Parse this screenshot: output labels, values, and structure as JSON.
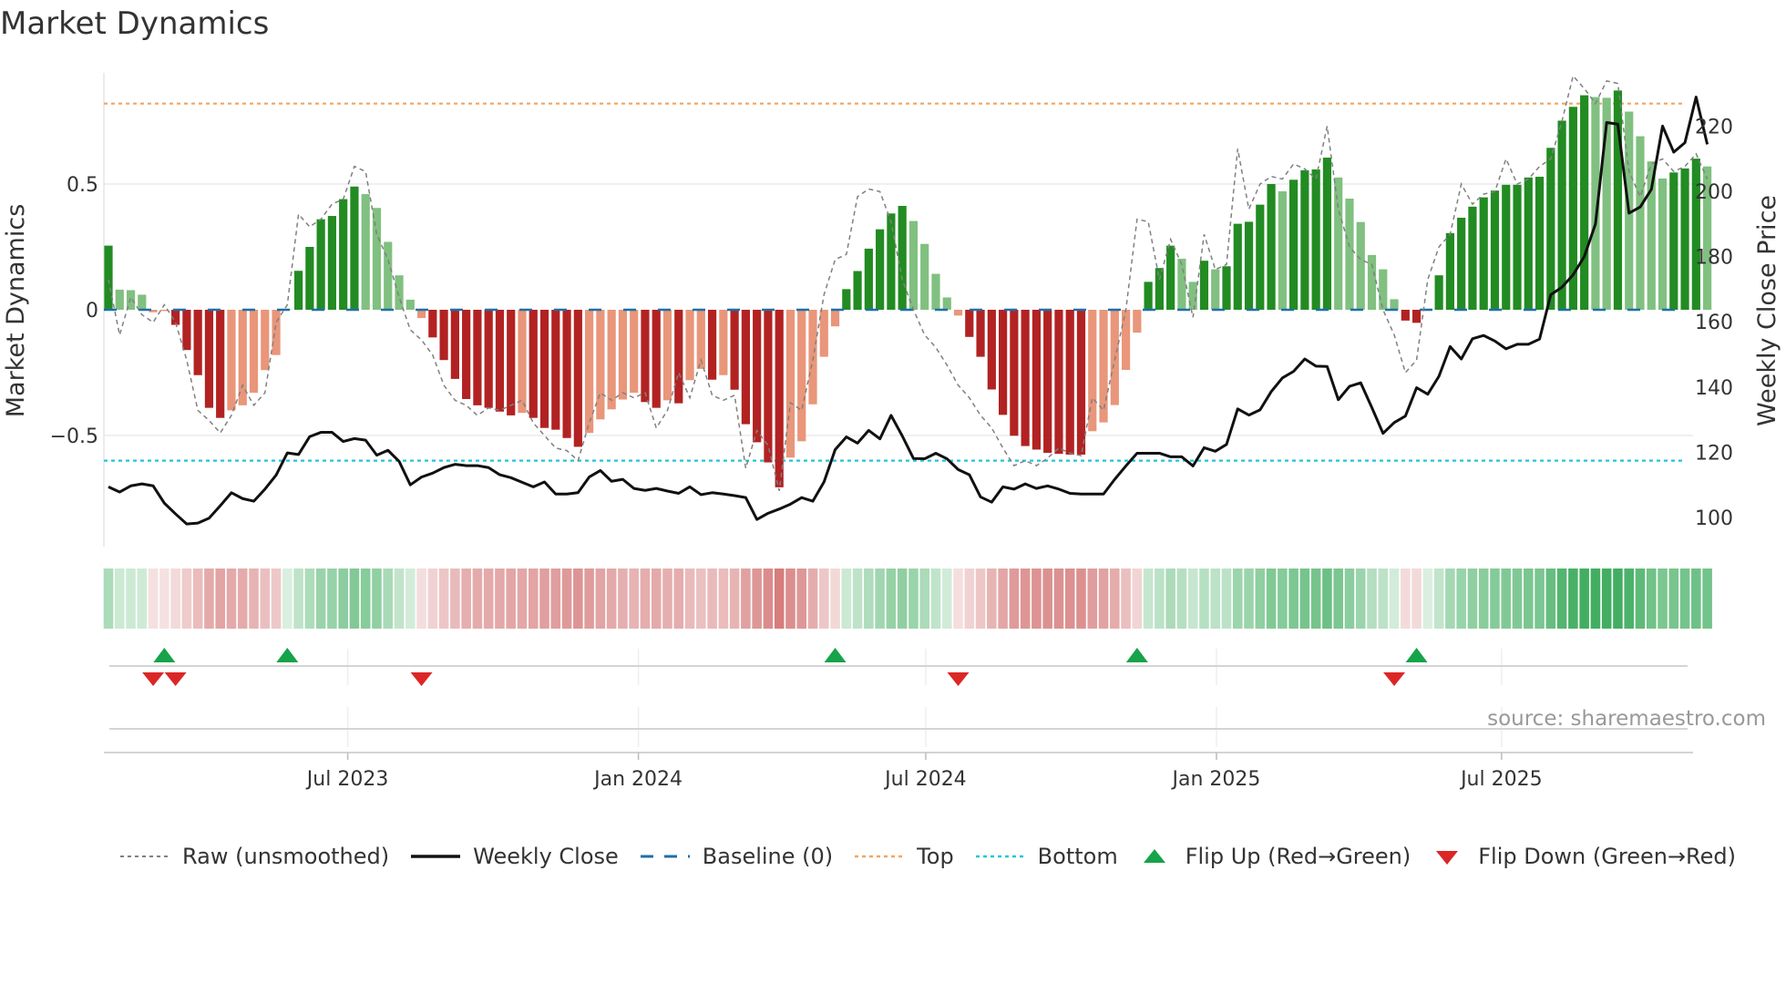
{
  "title": "Market Dynamics",
  "source": "source: sharemaestro.com",
  "chart_data": {
    "type": "bar",
    "title": "Market Dynamics",
    "ylabel_left": "Market Dynamics",
    "ylabel_right": "Weekly Close Price",
    "ylim_left": [
      -0.95,
      0.94
    ],
    "ylim_right": [
      93,
      233
    ],
    "yticks_left": [
      {
        "v": 0.5,
        "label": "0.5"
      },
      {
        "v": 0,
        "label": "0"
      },
      {
        "v": -0.5,
        "label": "−0.5"
      }
    ],
    "yticks_right": [
      {
        "v": 220,
        "label": "220"
      },
      {
        "v": 200,
        "label": "200"
      },
      {
        "v": 180,
        "label": "180"
      },
      {
        "v": 160,
        "label": "160"
      },
      {
        "v": 140,
        "label": "140"
      },
      {
        "v": 120,
        "label": "120"
      },
      {
        "v": 100,
        "label": "100"
      }
    ],
    "x_unit": "week index",
    "xticks": [
      {
        "week": 21.4,
        "label": "Jul 2023"
      },
      {
        "week": 47.4,
        "label": "Jan 2024"
      },
      {
        "week": 73.1,
        "label": "Jul 2024"
      },
      {
        "week": 99.1,
        "label": "Jan 2025"
      },
      {
        "week": 124.6,
        "label": "Jul 2025"
      }
    ],
    "top": 0.82,
    "bottom": -0.6,
    "baseline": 0,
    "smoothed": [
      0.255,
      0.08,
      0.078,
      0.06,
      -0.01,
      -0.005,
      -0.06,
      -0.16,
      -0.26,
      -0.39,
      -0.43,
      -0.4,
      -0.38,
      -0.33,
      -0.24,
      -0.18,
      0.002,
      0.155,
      0.25,
      0.36,
      0.373,
      0.44,
      0.49,
      0.46,
      0.405,
      0.27,
      0.137,
      0.04,
      -0.033,
      -0.11,
      -0.2,
      -0.275,
      -0.355,
      -0.38,
      -0.39,
      -0.405,
      -0.42,
      -0.41,
      -0.43,
      -0.47,
      -0.477,
      -0.51,
      -0.545,
      -0.49,
      -0.436,
      -0.396,
      -0.357,
      -0.33,
      -0.367,
      -0.39,
      -0.36,
      -0.372,
      -0.28,
      -0.235,
      -0.278,
      -0.26,
      -0.318,
      -0.455,
      -0.527,
      -0.607,
      -0.706,
      -0.588,
      -0.523,
      -0.376,
      -0.187,
      -0.066,
      0.082,
      0.154,
      0.243,
      0.32,
      0.383,
      0.413,
      0.353,
      0.262,
      0.143,
      0.049,
      -0.023,
      -0.108,
      -0.187,
      -0.317,
      -0.418,
      -0.501,
      -0.542,
      -0.556,
      -0.569,
      -0.573,
      -0.576,
      -0.576,
      -0.483,
      -0.448,
      -0.379,
      -0.239,
      -0.091,
      0.111,
      0.166,
      0.255,
      0.203,
      0.111,
      0.195,
      0.161,
      0.173,
      0.342,
      0.35,
      0.418,
      0.5,
      0.471,
      0.517,
      0.555,
      0.558,
      0.605,
      0.526,
      0.442,
      0.349,
      0.218,
      0.161,
      0.042,
      -0.043,
      -0.052,
      0.0,
      0.137,
      0.305,
      0.366,
      0.41,
      0.447,
      0.474,
      0.497,
      0.497,
      0.526,
      0.529,
      0.644,
      0.752,
      0.807,
      0.853,
      0.846,
      0.843,
      0.872,
      0.788,
      0.69,
      0.59,
      0.522,
      0.546,
      0.562,
      0.601,
      0.57
    ],
    "raw": [
      0.12,
      -0.1,
      0.05,
      -0.02,
      -0.05,
      0.02,
      -0.05,
      -0.2,
      -0.4,
      -0.44,
      -0.49,
      -0.42,
      -0.3,
      -0.38,
      -0.33,
      -0.05,
      0.02,
      0.38,
      0.33,
      0.36,
      0.42,
      0.44,
      0.57,
      0.55,
      0.3,
      0.2,
      0.05,
      -0.08,
      -0.12,
      -0.18,
      -0.3,
      -0.36,
      -0.38,
      -0.42,
      -0.39,
      -0.4,
      -0.38,
      -0.36,
      -0.45,
      -0.5,
      -0.55,
      -0.56,
      -0.6,
      -0.45,
      -0.33,
      -0.36,
      -0.33,
      -0.35,
      -0.33,
      -0.47,
      -0.4,
      -0.25,
      -0.35,
      -0.2,
      -0.34,
      -0.36,
      -0.34,
      -0.63,
      -0.48,
      -0.54,
      -0.72,
      -0.37,
      -0.4,
      -0.2,
      0.06,
      0.2,
      0.22,
      0.45,
      0.48,
      0.47,
      0.35,
      0.12,
      0.0,
      -0.1,
      -0.15,
      -0.22,
      -0.3,
      -0.35,
      -0.42,
      -0.47,
      -0.55,
      -0.62,
      -0.6,
      -0.62,
      -0.59,
      -0.55,
      -0.57,
      -0.58,
      -0.35,
      -0.4,
      -0.2,
      0.0,
      0.36,
      0.35,
      0.12,
      0.28,
      0.18,
      -0.03,
      0.3,
      0.16,
      0.18,
      0.64,
      0.4,
      0.5,
      0.53,
      0.52,
      0.58,
      0.56,
      0.52,
      0.73,
      0.4,
      0.25,
      0.2,
      0.18,
      0.0,
      -0.1,
      -0.25,
      -0.2,
      0.12,
      0.25,
      0.3,
      0.5,
      0.42,
      0.46,
      0.47,
      0.6,
      0.5,
      0.52,
      0.57,
      0.6,
      0.75,
      0.93,
      0.88,
      0.82,
      0.91,
      0.9,
      0.55,
      0.45,
      0.58,
      0.6,
      0.55,
      0.57,
      0.62,
      0.52
    ],
    "weekly_close": [
      109.4,
      107.8,
      109.7,
      110.3,
      109.7,
      104.4,
      101.1,
      98,
      98.3,
      99.8,
      103.6,
      107.6,
      105.8,
      105,
      108.7,
      113,
      119.8,
      119.3,
      124.8,
      126.1,
      126.1,
      123.3,
      124.2,
      123.7,
      119.1,
      120.6,
      117.2,
      110,
      112.4,
      113.6,
      115.3,
      116.3,
      115.9,
      115.9,
      115.3,
      113.1,
      112.2,
      110.8,
      109.4,
      110.9,
      107.2,
      107.2,
      107.6,
      112.4,
      114.4,
      111.1,
      111.7,
      108.9,
      108.3,
      108.9,
      108.1,
      107.4,
      109.4,
      107,
      107.6,
      107.2,
      106.7,
      106.1,
      99.4,
      101.3,
      102.6,
      104.1,
      106.1,
      105,
      110.9,
      120.8,
      124.7,
      122.8,
      126.7,
      124.1,
      131.3,
      125,
      118.1,
      118,
      119.7,
      118,
      114.7,
      113.1,
      106.3,
      104.7,
      109.4,
      108.7,
      110.3,
      108.9,
      109.7,
      108.7,
      107.4,
      107.2,
      107.2,
      107.2,
      111.7,
      115.8,
      119.7,
      119.7,
      119.7,
      118.6,
      118.6,
      115.8,
      121.4,
      120.3,
      122.4,
      133.3,
      131.4,
      133,
      138.6,
      142.8,
      144.8,
      148.6,
      146.4,
      146.3,
      136.1,
      140.2,
      141.3,
      133.7,
      125.8,
      129.1,
      131.1,
      139.8,
      137.8,
      143.3,
      152.4,
      148.6,
      154.8,
      155.8,
      154.1,
      151.7,
      153.1,
      153.1,
      154.7,
      168.3,
      170.6,
      174.4,
      180,
      190,
      221.1,
      220.6,
      193.3,
      195.2,
      200.6,
      220,
      212,
      214.9,
      228.9,
      214.4
    ],
    "flip_up_weeks": [
      5,
      16,
      65,
      92,
      117
    ],
    "flip_down_weeks": [
      4,
      6,
      28,
      76,
      115
    ],
    "legend": {
      "placement": "bottom",
      "items": [
        {
          "key": "raw",
          "label": "Raw (unsmoothed)"
        },
        {
          "key": "close",
          "label": "Weekly Close"
        },
        {
          "key": "baseline",
          "label": "Baseline (0)"
        },
        {
          "key": "top",
          "label": "Top"
        },
        {
          "key": "bottom",
          "label": "Bottom"
        },
        {
          "key": "flipup",
          "label": "Flip Up (Red→Green)"
        },
        {
          "key": "flipdown",
          "label": "Flip Down (Green→Red)"
        }
      ]
    },
    "colors": {
      "green_strong": "#228b22",
      "green_fading": "#80c080",
      "red_strong": "#b22222",
      "red_fading": "#e9967a",
      "raw": "#808080",
      "close": "#111111",
      "baseline": "#1f6fa8",
      "top": "#f4a460",
      "bottom": "#22c5d8",
      "flip_up": "#16a34a",
      "flip_down": "#dc2626"
    }
  }
}
